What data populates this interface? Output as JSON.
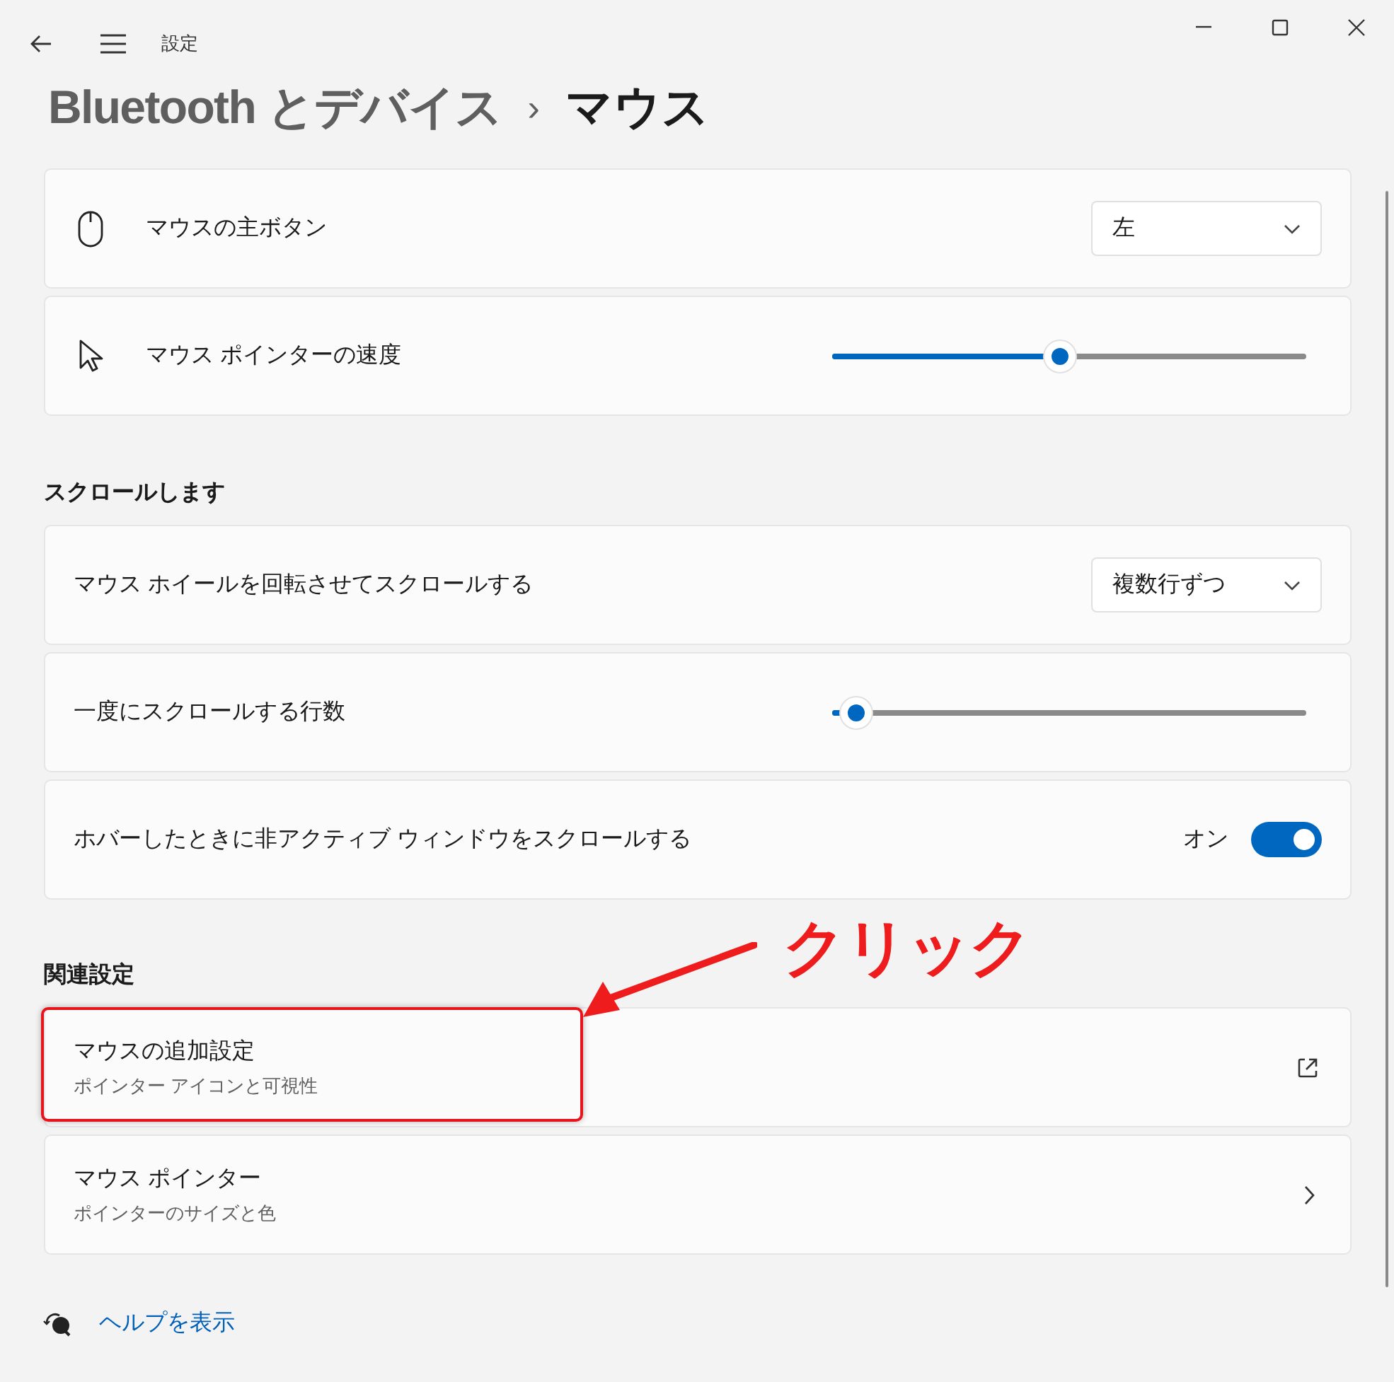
{
  "window": {
    "title": "設定"
  },
  "breadcrumb": {
    "parent": "Bluetooth とデバイス",
    "separator": "›",
    "current": "マウス"
  },
  "sections": [
    {
      "rows": [
        {
          "kind": "dropdown",
          "label": "マウスの主ボタン",
          "value": "左"
        },
        {
          "kind": "slider",
          "label": "マウス ポインターの速度",
          "level": 0.48
        }
      ]
    },
    {
      "heading": "スクロールします",
      "rows": [
        {
          "kind": "dropdown",
          "label": "マウス ホイールを回転させてスクロールする",
          "value": "複数行ずつ"
        },
        {
          "kind": "slider",
          "label": "一度にスクロールする行数",
          "level": 0.05
        },
        {
          "kind": "toggle",
          "label": "ホバーしたときに非アクティブ ウィンドウをスクロールする",
          "on": true,
          "state_label": "オン"
        }
      ]
    },
    {
      "heading": "関連設定",
      "rows": [
        {
          "kind": "external",
          "label": "マウスの追加設定",
          "description": "ポインター アイコンと可視性",
          "highlighted": true
        },
        {
          "kind": "link",
          "label": "マウス ポインター",
          "description": "ポインターのサイズと色",
          "highlighted": false
        }
      ]
    }
  ],
  "help_link": "ヘルプを表示",
  "annotation": {
    "text": "クリック"
  }
}
